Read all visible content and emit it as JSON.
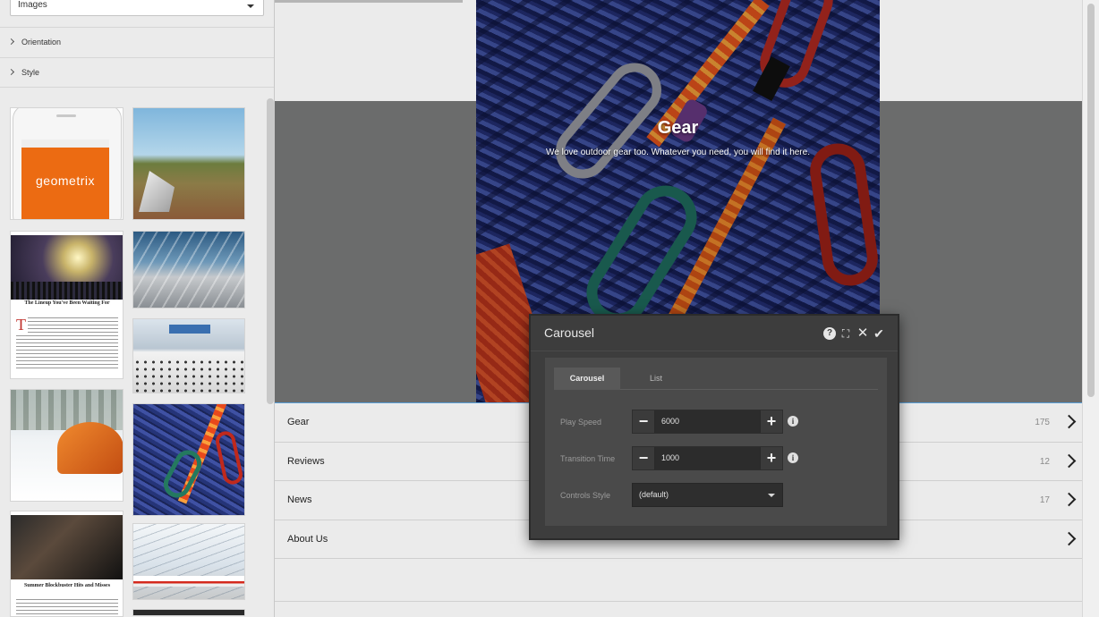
{
  "sidebar": {
    "asset_type": "Images",
    "sections": [
      {
        "label": "Orientation"
      },
      {
        "label": "Style"
      }
    ],
    "thumbnails": {
      "phone_brand": "geometrix",
      "article1_headline": "The Lineup You've Been Waiting For",
      "article2_headline": "Summer Blockbuster Hits and Misses"
    }
  },
  "hero": {
    "title": "Gear",
    "subtitle": "We love outdoor gear too. Whatever you need, you will find it here."
  },
  "list": {
    "items": [
      {
        "label": "Gear",
        "count": "175"
      },
      {
        "label": "Reviews",
        "count": "12"
      },
      {
        "label": "News",
        "count": "17"
      },
      {
        "label": "About Us",
        "count": ""
      }
    ]
  },
  "dialog": {
    "title": "Carousel",
    "icons": {
      "help": "?",
      "fullscreen": "⛶",
      "close": "✕",
      "done": "✔"
    },
    "tabs": [
      {
        "label": "Carousel",
        "active": true
      },
      {
        "label": "List",
        "active": false
      }
    ],
    "fields": {
      "play_speed": {
        "label": "Play Speed",
        "value": "6000"
      },
      "transition_time": {
        "label": "Transition Time",
        "value": "1000"
      },
      "controls_style": {
        "label": "Controls Style",
        "value": "(default)"
      }
    },
    "stepper_minus": "−",
    "stepper_plus": "+",
    "info": "i"
  }
}
